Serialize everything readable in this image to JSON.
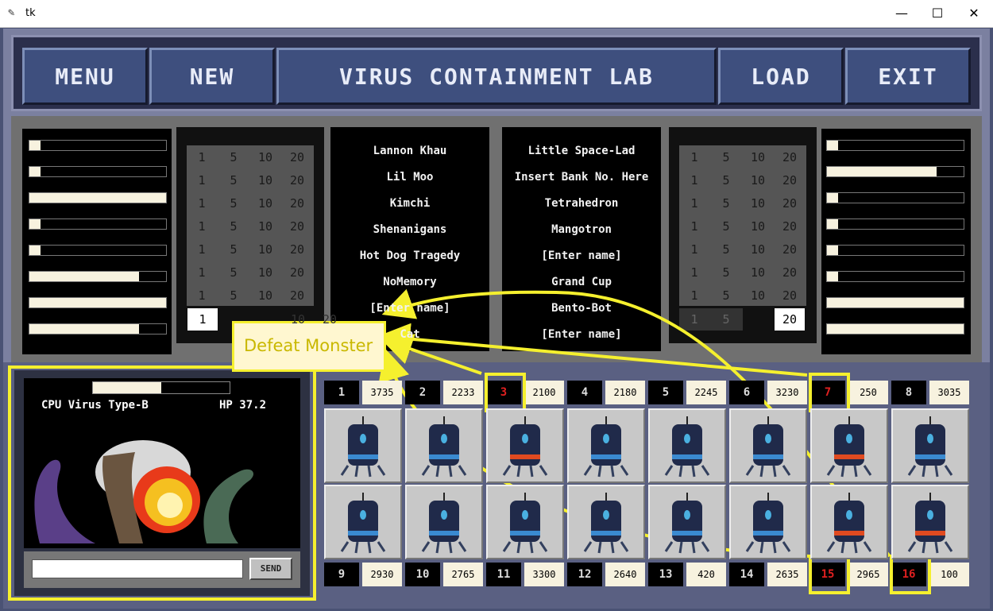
{
  "window": {
    "title": "tk",
    "minimize": "—",
    "maximize": "☐",
    "close": "✕"
  },
  "header": {
    "menu_label": "MENU",
    "new_label": "NEW",
    "title": "VIRUS CONTAINMENT LAB",
    "load_label": "LOAD",
    "exit_label": "EXIT"
  },
  "left_bars": [
    0.08,
    0.08,
    1.0,
    0.08,
    0.08,
    0.8,
    1.0,
    0.8
  ],
  "right_bars": [
    0.08,
    0.8,
    0.08,
    0.08,
    0.08,
    0.08,
    1.0,
    1.0
  ],
  "grid_options": [
    "1",
    "5",
    "10",
    "20"
  ],
  "left_grid_selected": "1",
  "right_grid_selected": "20",
  "left_names": [
    "Lannon Khau",
    "Lil Moo",
    "Kimchi",
    "Shenanigans",
    "Hot Dog Tragedy",
    "NoMemory",
    "[Enter name]",
    "Cat"
  ],
  "right_names": [
    "Little Space-Lad",
    "Insert Bank No. Here",
    "Tetrahedron",
    "Mangotron",
    "[Enter name]",
    "Grand Cup",
    "Bento-Bot",
    "[Enter name]"
  ],
  "monster": {
    "name": "CPU Virus Type-B",
    "hp": "HP 37.2",
    "hp_fraction": 0.5
  },
  "send": {
    "placeholder": "",
    "label": "SEND"
  },
  "top_slots": [
    {
      "n": "1",
      "v": "3735"
    },
    {
      "n": "2",
      "v": "2233"
    },
    {
      "n": "3",
      "v": "2100"
    },
    {
      "n": "4",
      "v": "2180"
    },
    {
      "n": "5",
      "v": "2245"
    },
    {
      "n": "6",
      "v": "3230"
    },
    {
      "n": "7",
      "v": "250"
    },
    {
      "n": "8",
      "v": "3035"
    }
  ],
  "bottom_slots": [
    {
      "n": "9",
      "v": "2930"
    },
    {
      "n": "10",
      "v": "2765"
    },
    {
      "n": "11",
      "v": "3300"
    },
    {
      "n": "12",
      "v": "2640"
    },
    {
      "n": "13",
      "v": "420"
    },
    {
      "n": "14",
      "v": "2635"
    },
    {
      "n": "15",
      "v": "2965"
    },
    {
      "n": "16",
      "v": "100"
    }
  ],
  "highlighted_slots": [
    "3",
    "7",
    "15",
    "16"
  ],
  "annotation": {
    "label": "Defeat Monster"
  },
  "colors": {
    "accent": "#f5f02e",
    "slot_red": "#e02020",
    "cream": "#f7f2df",
    "button": "#3e4f7e"
  }
}
